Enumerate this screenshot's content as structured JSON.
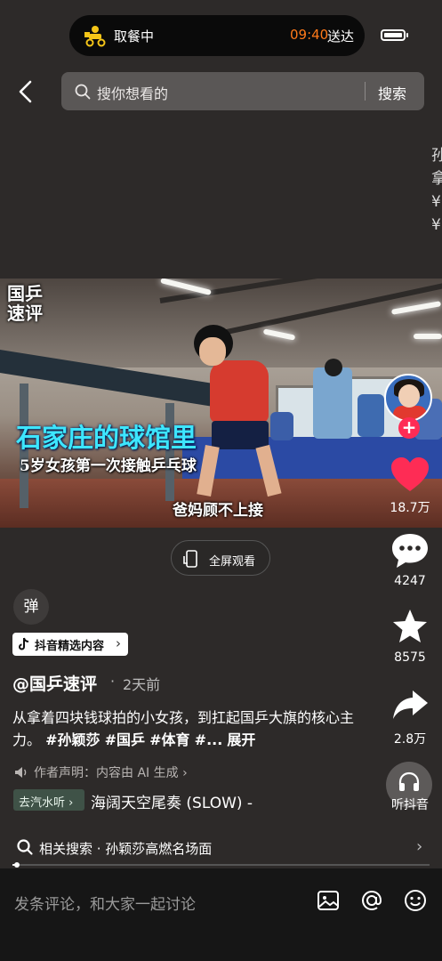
{
  "status": {
    "pill_text": "取餐中",
    "pickup_time": "09:40",
    "pickup_suffix": "送达",
    "brand_color": "#ff7a1a"
  },
  "search": {
    "placeholder": "搜你想看的",
    "button_label": "搜索"
  },
  "edge_text": "孙 拿 ¥ ¥",
  "video": {
    "corner_logo": "国乒速评",
    "headline": "石家庄的球馆里",
    "subline": "5岁女孩第一次接触乒乓球",
    "caption": "爸妈顾不上接",
    "fullscreen_label": "全屏观看"
  },
  "rail": {
    "likes": "18.7万",
    "comments": "4247",
    "favorites": "8575",
    "shares": "2.8万",
    "listen_label": "听抖音",
    "like_color": "#fe2c55"
  },
  "info": {
    "danmaku_label": "弹",
    "selected_tag": "抖音精选内容",
    "author": "@国乒速评",
    "time_ago": "2天前",
    "desc_text": "从拿着四块钱球拍的小女孩，到扛起国乒大旗的核心主力。",
    "hashtags": [
      "#孙颖莎",
      "#国乒",
      "#体育",
      "#..."
    ],
    "expand_label": "展开",
    "ai_notice": "作者声明：内容由 AI 生成",
    "music_tag": "去汽水听",
    "music_title": "海阔天空尾奏 (SLOW) -"
  },
  "related": {
    "label": "相关搜索 · 孙颖莎高燃名场面"
  },
  "progress": 0.01,
  "comment_bar": {
    "placeholder": "发条评论，和大家一起讨论",
    "icons": [
      "image-icon",
      "at-icon",
      "emoji-icon"
    ]
  }
}
